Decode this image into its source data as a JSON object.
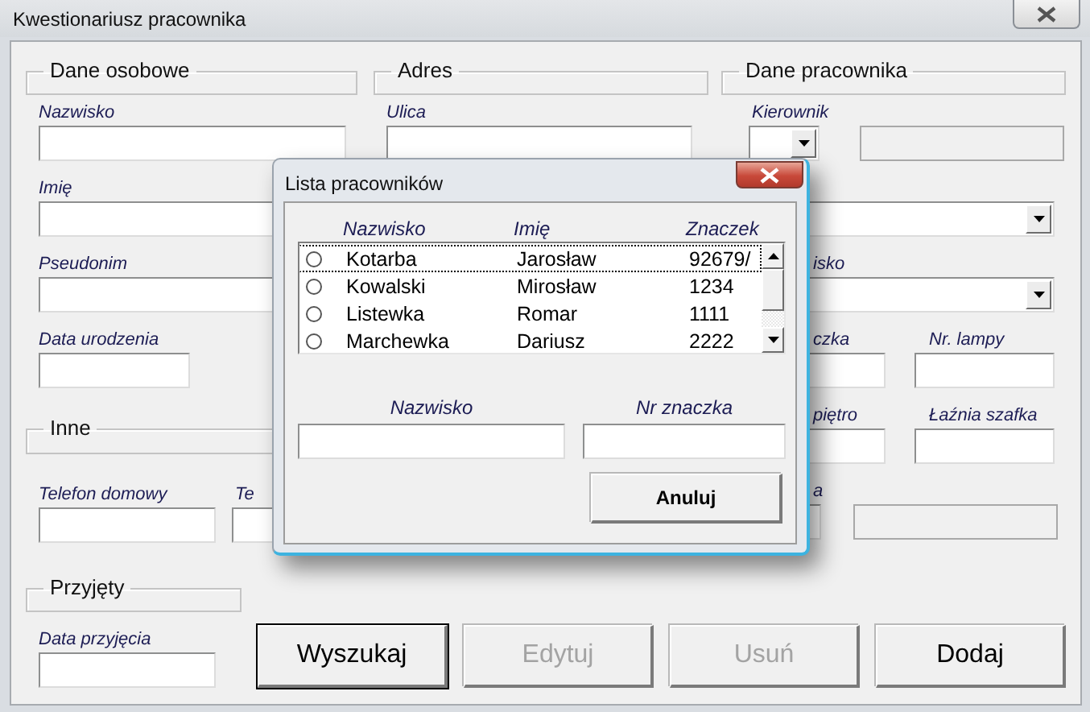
{
  "window": {
    "title": "Kwestionariusz pracownika"
  },
  "personal": {
    "title": "Dane osobowe",
    "fields": [
      {
        "label": "Nazwisko"
      },
      {
        "label": "Imię"
      },
      {
        "label": "Pseudonim"
      },
      {
        "label": "Data urodzenia"
      }
    ]
  },
  "address": {
    "title": "Adres",
    "fields": [
      {
        "label": "Ulica"
      }
    ]
  },
  "employee": {
    "title": "Dane pracownika",
    "rows": [
      {
        "cells": [
          {
            "kind": "combo",
            "label": "Kierownik",
            "disabled": false
          },
          {
            "kind": "text",
            "disabled": true
          }
        ]
      },
      {
        "cells": [
          {
            "kind": "combo",
            "disabled": false
          }
        ]
      },
      {
        "cells": [
          {
            "kind": "combo",
            "label": "isko",
            "disabled": false
          }
        ]
      },
      {
        "cells": [
          {
            "kind": "text",
            "label": "czka",
            "disabled": false
          },
          {
            "kind": "text",
            "label": "Nr. lampy",
            "disabled": false
          }
        ]
      },
      {
        "cells": [
          {
            "kind": "text",
            "label": "piętro",
            "disabled": false
          },
          {
            "kind": "text",
            "label": "Łaźnia szafka",
            "disabled": false
          }
        ]
      },
      {
        "cells": [
          {
            "kind": "text",
            "label": "a",
            "disabled": false
          },
          {
            "kind": "text",
            "disabled": true
          }
        ]
      }
    ]
  },
  "other": {
    "title": "Inne",
    "fields": [
      {
        "label": "Telefon domowy"
      },
      {
        "label": "Te"
      }
    ]
  },
  "hired": {
    "title": "Przyjęty",
    "fields": [
      {
        "label": "Data przyjęcia"
      }
    ]
  },
  "buttons": [
    {
      "label": "Wyszukaj",
      "disabled": false,
      "focused": true
    },
    {
      "label": "Edytuj",
      "disabled": true,
      "focused": false
    },
    {
      "label": "Usuń",
      "disabled": true,
      "focused": false
    },
    {
      "label": "Dodaj",
      "disabled": false,
      "focused": false
    }
  ],
  "dialog": {
    "title": "Lista pracowników",
    "columns": [
      "Nazwisko",
      "Imię",
      "Znaczek"
    ],
    "rows": [
      {
        "surname": "Kotarba",
        "first_name": "Jarosław",
        "badge": "92679/",
        "selected": false,
        "focused": true
      },
      {
        "surname": "Kowalski",
        "first_name": "Mirosław",
        "badge": "1234",
        "selected": false,
        "focused": false
      },
      {
        "surname": "Listewka",
        "first_name": "Romar",
        "badge": "1111",
        "selected": false,
        "focused": false
      },
      {
        "surname": "Marchewka",
        "first_name": "Dariusz",
        "badge": "2222",
        "selected": false,
        "focused": false
      }
    ],
    "search": [
      {
        "label": "Nazwisko"
      },
      {
        "label": "Nr znaczka"
      }
    ],
    "button": "Anuluj"
  }
}
